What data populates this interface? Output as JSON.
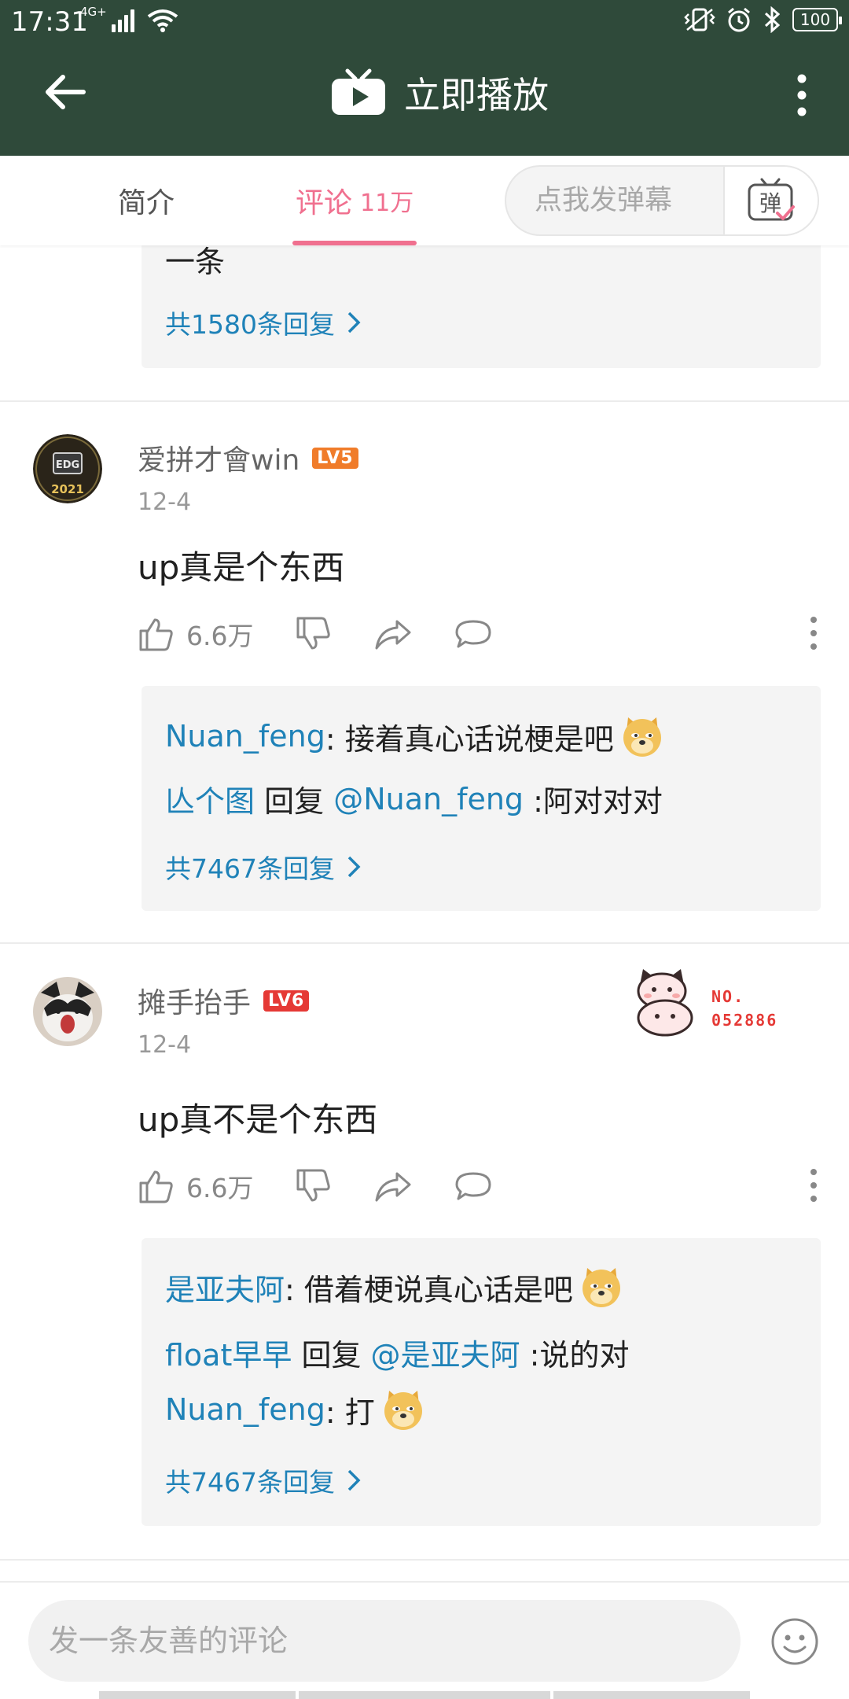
{
  "status_bar": {
    "time": "17:31",
    "network": "4G+",
    "battery": "100"
  },
  "app_bar": {
    "title": "立即播放"
  },
  "tabs": {
    "intro": "简介",
    "comments": "评论",
    "comments_count": "11万"
  },
  "danmaku": {
    "placeholder": "点我发弹幕",
    "button_char": "弹"
  },
  "top_partial": {
    "text_tail": "一条",
    "more_replies": "共1580条回复"
  },
  "comments": [
    {
      "username": "爱拼才會win",
      "level": "LV5",
      "level_color": "#f07c2a",
      "avatar_badge": "2021",
      "date": "12-4",
      "content": "up真是个东西",
      "likes": "6.6万",
      "replies": [
        {
          "user": "Nuan_feng",
          "text": ": 接着真心话说梗是吧",
          "emoji": "doge"
        },
        {
          "user": "亾个图",
          "reply_word": " 回复 ",
          "target": "@Nuan_feng",
          "text": " :阿对对对"
        }
      ],
      "more_replies": "共7467条回复"
    },
    {
      "username": "摊手抬手",
      "level": "LV6",
      "level_color": "#e53935",
      "date": "12-4",
      "content": "up真不是个东西",
      "likes": "6.6万",
      "fan_badge": {
        "label": "NO.",
        "number": "052886"
      },
      "replies": [
        {
          "user": "是亚夫阿",
          "text": ": 借着梗说真心话是吧",
          "emoji": "doge"
        },
        {
          "user": "float早早",
          "reply_word": " 回复 ",
          "target": "@是亚夫阿",
          "text": " :说的对"
        },
        {
          "user": "Nuan_feng",
          "text": ": 打",
          "emoji": "doge"
        }
      ],
      "more_replies": "共7467条回复"
    }
  ],
  "bottom": {
    "placeholder": "发一条友善的评论"
  },
  "icons": {
    "back": "arrow-left-icon",
    "play": "tv-play-icon",
    "more": "more-vertical-icon",
    "like": "thumb-up-icon",
    "dislike": "thumb-down-icon",
    "share": "share-icon",
    "reply": "chat-bubble-icon",
    "emoji": "smile-icon"
  },
  "colors": {
    "app_bar": "#2f4a3a",
    "accent_pink": "#f0708f",
    "link_blue": "#1f82b8"
  }
}
